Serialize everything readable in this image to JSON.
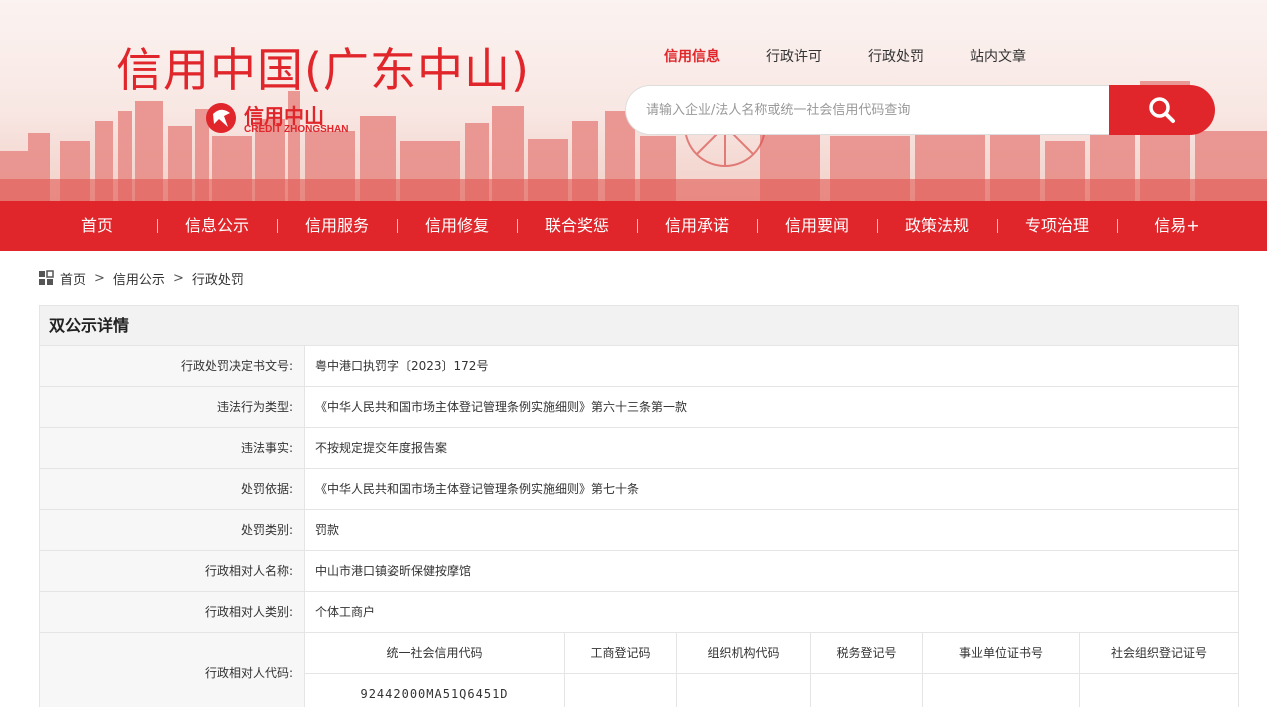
{
  "header": {
    "site_title": "信用中国(广东中山)",
    "logo_cn": "信用中山",
    "logo_en": "CREDIT ZHONGSHAN",
    "top_links": [
      "信用信息",
      "行政许可",
      "行政处罚",
      "站内文章"
    ],
    "active_top_link": "信用信息",
    "search_placeholder": "请输入企业/法人名称或统一社会信用代码查询",
    "search_icon": "search-icon"
  },
  "nav": {
    "items": [
      "首页",
      "信息公示",
      "信用服务",
      "信用修复",
      "联合奖惩",
      "信用承诺",
      "信用要闻",
      "政策法规",
      "专项治理",
      "信易+"
    ]
  },
  "breadcrumb": {
    "icon": "grid-icon",
    "items": [
      "首页",
      "信用公示",
      "行政处罚"
    ]
  },
  "panel": {
    "title": "双公示详情",
    "rows": [
      {
        "label": "行政处罚决定书文号:",
        "value": "粤中港口执罚字〔2023〕172号"
      },
      {
        "label": "违法行为类型:",
        "value": "《中华人民共和国市场主体登记管理条例实施细则》第六十三条第一款"
      },
      {
        "label": "违法事实:",
        "value": "不按规定提交年度报告案"
      },
      {
        "label": "处罚依据:",
        "value": "《中华人民共和国市场主体登记管理条例实施细则》第七十条"
      },
      {
        "label": "处罚类别:",
        "value": "罚款"
      },
      {
        "label": "行政相对人名称:",
        "value": "中山市港口镇姿昕保健按摩馆"
      },
      {
        "label": "行政相对人类别:",
        "value": "个体工商户"
      }
    ],
    "code_row": {
      "label": "行政相对人代码:",
      "headers": [
        "统一社会信用代码",
        "工商登记码",
        "组织机构代码",
        "税务登记号",
        "事业单位证书号",
        "社会组织登记证号"
      ],
      "values": [
        "92442000MA51Q6451D",
        "",
        "",
        "",
        "",
        ""
      ]
    }
  },
  "colors": {
    "brand_red": "#e0262b",
    "label_bg": "#f7f7f7",
    "border": "#e5e5e5"
  }
}
